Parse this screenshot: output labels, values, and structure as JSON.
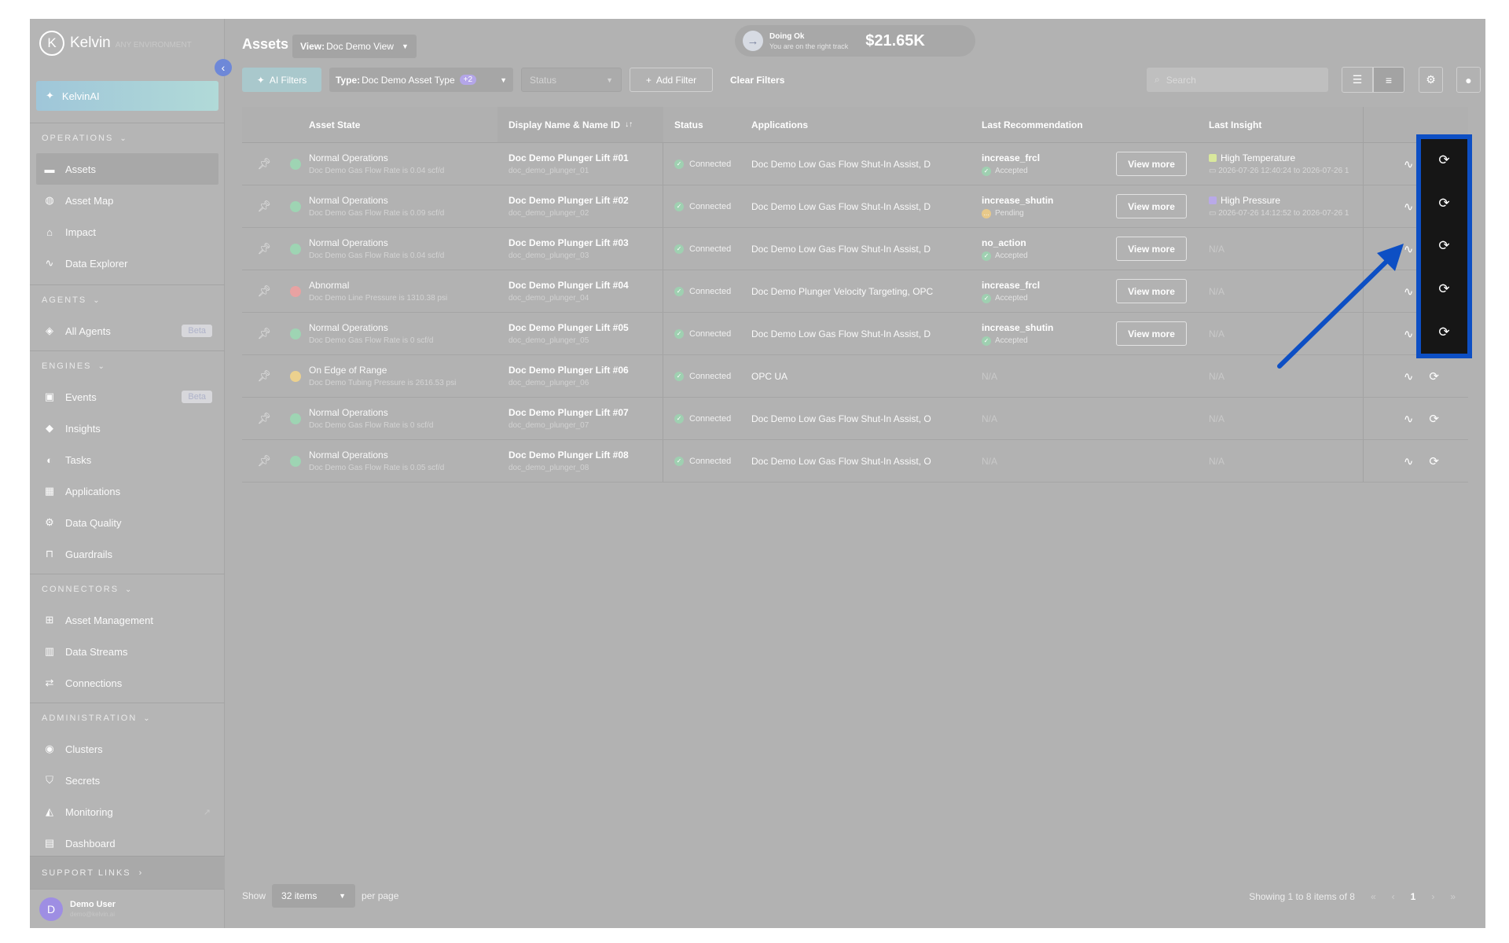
{
  "app": {
    "logo_letter": "K",
    "name": "Kelvin",
    "subtitle": "ANY ENVIRONMENT"
  },
  "sidebar": {
    "kelvin_ai": "KelvinAI",
    "sections": [
      {
        "title": "OPERATIONS",
        "items": [
          {
            "label": "Assets",
            "icon": "assets-icon",
            "active": true
          },
          {
            "label": "Asset Map",
            "icon": "globe-icon"
          },
          {
            "label": "Impact",
            "icon": "impact-icon"
          },
          {
            "label": "Data Explorer",
            "icon": "pulse-icon"
          }
        ]
      },
      {
        "title": "AGENTS",
        "items": [
          {
            "label": "All Agents",
            "icon": "agent-icon",
            "badge": "Beta"
          }
        ]
      },
      {
        "title": "ENGINES",
        "items": [
          {
            "label": "Events",
            "icon": "events-icon",
            "badge": "Beta"
          },
          {
            "label": "Insights",
            "icon": "tag-icon"
          },
          {
            "label": "Tasks",
            "icon": "tasks-icon"
          },
          {
            "label": "Applications",
            "icon": "apps-icon"
          },
          {
            "label": "Data Quality",
            "icon": "gear-icon"
          },
          {
            "label": "Guardrails",
            "icon": "guardrails-icon"
          }
        ]
      },
      {
        "title": "CONNECTORS",
        "items": [
          {
            "label": "Asset Management",
            "icon": "hierarchy-icon"
          },
          {
            "label": "Data Streams",
            "icon": "streams-icon"
          },
          {
            "label": "Connections",
            "icon": "connections-icon"
          }
        ]
      },
      {
        "title": "ADMINISTRATION",
        "items": [
          {
            "label": "Clusters",
            "icon": "clusters-icon"
          },
          {
            "label": "Secrets",
            "icon": "shield-icon"
          },
          {
            "label": "Monitoring",
            "icon": "monitoring-icon",
            "external": true
          },
          {
            "label": "Dashboard",
            "icon": "dashboard-icon"
          }
        ]
      }
    ],
    "support": "SUPPORT LINKS",
    "user": {
      "initial": "D",
      "name": "Demo User",
      "email": "demo@kelvin.ai"
    }
  },
  "header": {
    "title": "Assets",
    "view_prefix": "View:",
    "view_value": "Doc Demo View",
    "status_title": "Doing Ok",
    "status_sub": "You are on the right track",
    "amount": "$21.65K"
  },
  "filters": {
    "ai": "AI Filters",
    "type_prefix": "Type:",
    "type_value": "Doc Demo Asset Type",
    "type_more": "+2",
    "status": "Status",
    "add": "Add Filter",
    "clear": "Clear Filters",
    "search_placeholder": "Search"
  },
  "table": {
    "headers": {
      "state": "Asset State",
      "name": "Display Name & Name ID",
      "status": "Status",
      "apps": "Applications",
      "rec": "Last Recommendation",
      "insight": "Last Insight"
    },
    "view_more": "View more",
    "rows": [
      {
        "state": "Normal Operations",
        "state_detail": "Doc Demo Gas Flow Rate is 0.04 scf/d",
        "dot": "#9ed4b3",
        "name": "Doc Demo Plunger Lift #01",
        "id": "doc_demo_plunger_01",
        "status": "Connected",
        "apps": "Doc Demo Low Gas Flow Shut-In Assist, D",
        "rec": "increase_frcl",
        "rec_status": "Accepted",
        "rec_color": "#9fd0b1",
        "insight": "High Temperature",
        "insight_color": "#d9e89c",
        "insight_time": "2026-07-26 12:40:24 to 2026-07-26 1"
      },
      {
        "state": "Normal Operations",
        "state_detail": "Doc Demo Gas Flow Rate is 0.09 scf/d",
        "dot": "#9ed4b3",
        "name": "Doc Demo Plunger Lift #02",
        "id": "doc_demo_plunger_02",
        "status": "Connected",
        "apps": "Doc Demo Low Gas Flow Shut-In Assist, D",
        "rec": "increase_shutin",
        "rec_status": "Pending",
        "rec_color": "#e8c98a",
        "insight": "High Pressure",
        "insight_color": "#b9a9e8",
        "insight_time": "2026-07-26 14:12:52 to 2026-07-26 1"
      },
      {
        "state": "Normal Operations",
        "state_detail": "Doc Demo Gas Flow Rate is 0.04 scf/d",
        "dot": "#9ed4b3",
        "name": "Doc Demo Plunger Lift #03",
        "id": "doc_demo_plunger_03",
        "status": "Connected",
        "apps": "Doc Demo Low Gas Flow Shut-In Assist, D",
        "rec": "no_action",
        "rec_status": "Accepted",
        "rec_color": "#9fd0b1",
        "insight": "N/A"
      },
      {
        "state": "Abnormal",
        "state_detail": "Doc Demo Line Pressure is 1310.38 psi",
        "dot": "#e8a2a2",
        "name": "Doc Demo Plunger Lift #04",
        "id": "doc_demo_plunger_04",
        "status": "Connected",
        "apps": "Doc Demo Plunger Velocity Targeting, OPC",
        "rec": "increase_frcl",
        "rec_status": "Accepted",
        "rec_color": "#9fd0b1",
        "insight": "N/A"
      },
      {
        "state": "Normal Operations",
        "state_detail": "Doc Demo Gas Flow Rate is 0 scf/d",
        "dot": "#9ed4b3",
        "name": "Doc Demo Plunger Lift #05",
        "id": "doc_demo_plunger_05",
        "status": "Connected",
        "apps": "Doc Demo Low Gas Flow Shut-In Assist, D",
        "rec": "increase_shutin",
        "rec_status": "Accepted",
        "rec_color": "#9fd0b1",
        "insight": "N/A"
      },
      {
        "state": "On Edge of Range",
        "state_detail": "Doc Demo Tubing Pressure is 2616.53 psi",
        "dot": "#ecd18e",
        "name": "Doc Demo Plunger Lift #06",
        "id": "doc_demo_plunger_06",
        "status": "Connected",
        "apps": "OPC UA",
        "rec": "N/A",
        "insight": "N/A"
      },
      {
        "state": "Normal Operations",
        "state_detail": "Doc Demo Gas Flow Rate is 0 scf/d",
        "dot": "#9ed4b3",
        "name": "Doc Demo Plunger Lift #07",
        "id": "doc_demo_plunger_07",
        "status": "Connected",
        "apps": "Doc Demo Low Gas Flow Shut-In Assist, O",
        "rec": "N/A",
        "insight": "N/A"
      },
      {
        "state": "Normal Operations",
        "state_detail": "Doc Demo Gas Flow Rate is 0.05 scf/d",
        "dot": "#9ed4b3",
        "name": "Doc Demo Plunger Lift #08",
        "id": "doc_demo_plunger_08",
        "status": "Connected",
        "apps": "Doc Demo Low Gas Flow Shut-In Assist, O",
        "rec": "N/A",
        "insight": "N/A"
      }
    ]
  },
  "footer": {
    "show": "Show",
    "per_page_value": "32 items",
    "per_page": "per page",
    "showing": "Showing 1 to 8 items of 8",
    "page": "1"
  },
  "colors": {
    "highlight": "#0d4fc4",
    "accent": "#6e88d8"
  }
}
